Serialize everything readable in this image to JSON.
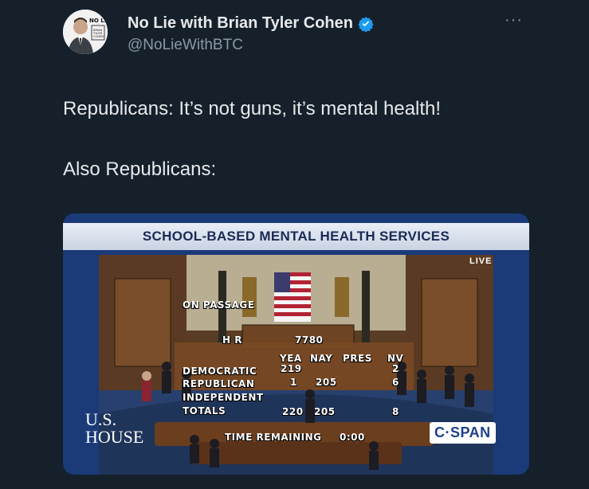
{
  "tweet": {
    "display_name": "No Lie with Brian Tyler Cohen",
    "handle": "@NoLieWithBTC",
    "more_label": "···",
    "text_line1": "Republicans: It’s not guns, it’s mental health!",
    "text_line2": "Also Republicans:"
  },
  "avatar": {
    "logo_text": "NO LIE",
    "logo_sub": "BRIAN TYLER COHEN"
  },
  "media": {
    "banner": "SCHOOL-BASED MENTAL HEALTH SERVICES",
    "live": "LIVE",
    "on_passage": "ON PASSAGE",
    "hr_label": "H R",
    "hr_number": "7780",
    "col_yea": "YEA",
    "col_nay": "NAY",
    "col_pres": "PRES",
    "col_nv": "NV",
    "row_dem": "DEMOCRATIC",
    "row_rep": "REPUBLICAN",
    "row_ind": "INDEPENDENT",
    "row_tot": "TOTALS",
    "dem_yea": "219",
    "dem_nv": "2",
    "rep_yea": "1",
    "rep_nay": "205",
    "rep_nv": "6",
    "tot_yea": "220",
    "tot_nay": "205",
    "tot_nv": "8",
    "time_label": "TIME REMAINING",
    "time_value": "0:00",
    "ushouse_1": "U.S.",
    "ushouse_2": "HOUSE",
    "cspan": "C·SPAN"
  },
  "colors": {
    "background": "#15202b",
    "verified": "#1d9bf0",
    "banner_text": "#1a2a55"
  }
}
